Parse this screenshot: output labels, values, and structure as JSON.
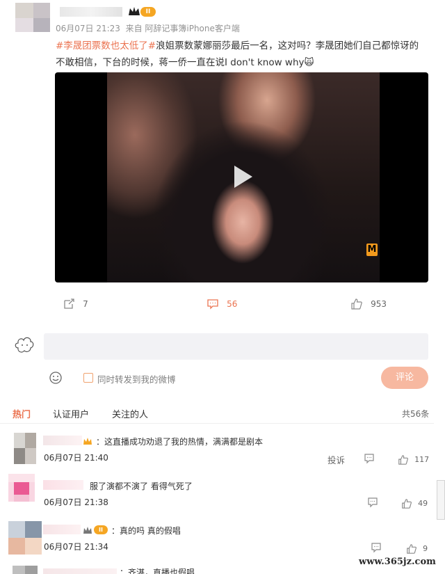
{
  "post": {
    "meta": "06月07日 21:23  来自 阿辞记事簿iPhone客户端",
    "hashtag": "#李晟团票数也太低了#",
    "text_line1": "浪姐票数蒙娜丽莎最后一名，这对吗？李晟团她们自己都惊讶的",
    "text_line2": "不敢相信，下台的时候，蒋一侨一直在说I don't know why",
    "emoji": "🙀",
    "badge": "II",
    "video_logo": "M"
  },
  "actions": {
    "repost_count": "7",
    "comment_count": "56",
    "like_count": "953"
  },
  "composer": {
    "placeholder": "",
    "repost_checkbox_label": "同时转发到我的微博",
    "submit_label": "评论"
  },
  "comment_tabs": {
    "hot": "热门",
    "verified": "认证用户",
    "following": "关注的人",
    "total": "共56条"
  },
  "comments": [
    {
      "text": "：这直播成功劝退了我的热情，满满都是剧本",
      "time": "06月07日 21:40",
      "report": "投诉",
      "likes": "117"
    },
    {
      "text": "服了演都不演了 看得气死了",
      "time": "06月07日 21:38",
      "likes": "49"
    },
    {
      "text": "：真的吗 真的假唱",
      "time": "06月07日 21:34",
      "likes": "9",
      "badge": "II"
    },
    {
      "text": "：齐湛，直播也假唱"
    }
  ],
  "watermark": "www.365jz.com",
  "colors": {
    "accent": "#eb7350",
    "submit_bg": "#f7b8a0",
    "input_bg": "#f2f2f5",
    "video_bg": "#000000"
  }
}
